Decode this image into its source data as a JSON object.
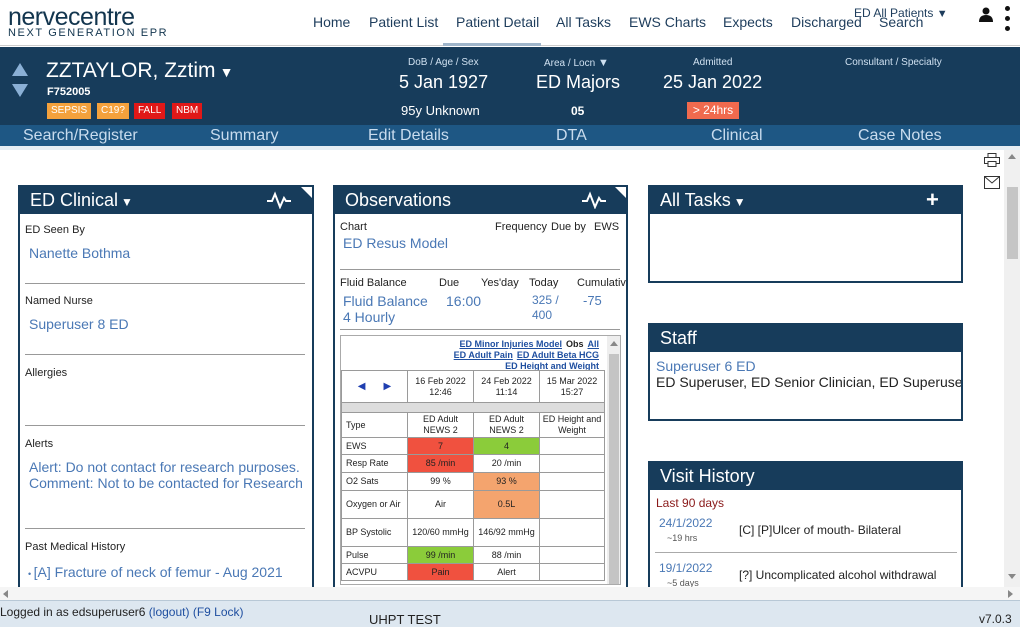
{
  "header": {
    "logo_main": "nervecentre",
    "logo_sub": "NEXT GENERATION EPR",
    "nav": [
      "Home",
      "Patient List",
      "Patient Detail",
      "All Tasks",
      "EWS Charts",
      "Expects",
      "Discharged",
      "Search"
    ],
    "active_nav": "Patient Detail",
    "ward_selector": "ED All Patients",
    "icons": [
      "user-icon",
      "kebab-menu-icon"
    ]
  },
  "patient": {
    "name": "ZZTAYLOR, Zztim",
    "id": "F752005",
    "badges": [
      {
        "label": "SEPSIS",
        "color": "#f4a13c"
      },
      {
        "label": "C19?",
        "color": "#f4a13c"
      },
      {
        "label": "FALL",
        "color": "#e01818"
      },
      {
        "label": "NBM",
        "color": "#e01818"
      }
    ],
    "dob_label": "DoB / Age / Sex",
    "dob": "5 Jan 1927",
    "age_sex": "95y Unknown",
    "area_label": "Area / Locn",
    "area": "ED Majors",
    "locn": "05",
    "admitted_label": "Admitted",
    "admitted": "25 Jan 2022",
    "admitted_flag": "> 24hrs",
    "consultant_label": "Consultant / Specialty"
  },
  "subnav": [
    "Search/Register",
    "Summary",
    "Edit Details",
    "DTA",
    "Clinical",
    "Case Notes"
  ],
  "ed_clinical": {
    "title": "ED Clinical",
    "seen_by_label": "ED Seen By",
    "seen_by": "Nanette Bothma",
    "nurse_label": "Named Nurse",
    "nurse": "Superuser 8 ED",
    "allergies_label": "Allergies",
    "alerts_label": "Alerts",
    "alerts": "Alert: Do not contact for research purposes. Comment: Not to be contacted for Research",
    "pmh_label": "Past Medical History",
    "pmh_item": "[A] Fracture of neck of femur - Aug 2021"
  },
  "observations": {
    "title": "Observations",
    "chart_label": "Chart",
    "frequency_label": "Frequency",
    "due_by_label": "Due by",
    "ews_label": "EWS",
    "chart_value": "ED Resus Model",
    "fb_label": "Fluid Balance",
    "fb_due_label": "Due",
    "fb_yesday_label": "Yes'day",
    "fb_today_label": "Today",
    "fb_cum_label": "Cumulative",
    "fb_value": "Fluid Balance 4 Hourly",
    "fb_due": "16:00",
    "fb_today": "325 / 400",
    "fb_cum": "-75",
    "links": [
      "ED Minor Injuries Model",
      "Obs",
      "All",
      "ED Adult Pain",
      "ED Adult Beta HCG",
      "ED Height and Weight"
    ],
    "dates": [
      "16 Feb 2022 12:46",
      "24 Feb 2022 11:14",
      "15 Mar 2022 15:27"
    ],
    "type_label": "Type",
    "types": [
      "ED Adult NEWS 2",
      "ED Adult NEWS 2",
      "ED Height and Weight"
    ],
    "rows": [
      {
        "label": "EWS",
        "v1": "7",
        "c1": "red",
        "v2": "4",
        "c2": "grn",
        "v3": ""
      },
      {
        "label": "Resp Rate",
        "v1": "85 /min",
        "c1": "red",
        "v2": "20 /min",
        "c2": "",
        "v3": ""
      },
      {
        "label": "O2 Sats",
        "v1": "99 %",
        "c1": "",
        "v2": "93 %",
        "c2": "org",
        "v3": ""
      },
      {
        "label": "Oxygen or Air",
        "v1": "Air",
        "c1": "",
        "v2": "0.5L",
        "c2": "org",
        "v3": ""
      },
      {
        "label": "BP Systolic",
        "v1": "120/60 mmHg",
        "c1": "",
        "v2": "146/92 mmHg",
        "c2": "",
        "v3": ""
      },
      {
        "label": "Pulse",
        "v1": "99 /min",
        "c1": "grn",
        "v2": "88 /min",
        "c2": "",
        "v3": ""
      },
      {
        "label": "ACVPU",
        "v1": "Pain",
        "c1": "red",
        "v2": "Alert",
        "c2": "",
        "v3": ""
      }
    ]
  },
  "all_tasks": {
    "title": "All Tasks",
    "add": "+"
  },
  "staff": {
    "title": "Staff",
    "name": "Superuser 6 ED",
    "roles": "ED Superuser, ED Senior Clinician, ED Superuser"
  },
  "visit_history": {
    "title": "Visit History",
    "period": "Last 90 days",
    "visits": [
      {
        "date": "24/1/2022",
        "ago": "~19 hrs",
        "desc": "[C] [P]Ulcer of mouth- Bilateral"
      },
      {
        "date": "19/1/2022",
        "ago": "~5 days",
        "desc": "[?] Uncomplicated alcohol withdrawal"
      }
    ]
  },
  "footer": {
    "logged_in": "Logged in as edsuperuser6",
    "logout": "(logout)",
    "lock": "(F9 Lock)",
    "env": "UHPT TEST",
    "version": "v7.0.3"
  }
}
